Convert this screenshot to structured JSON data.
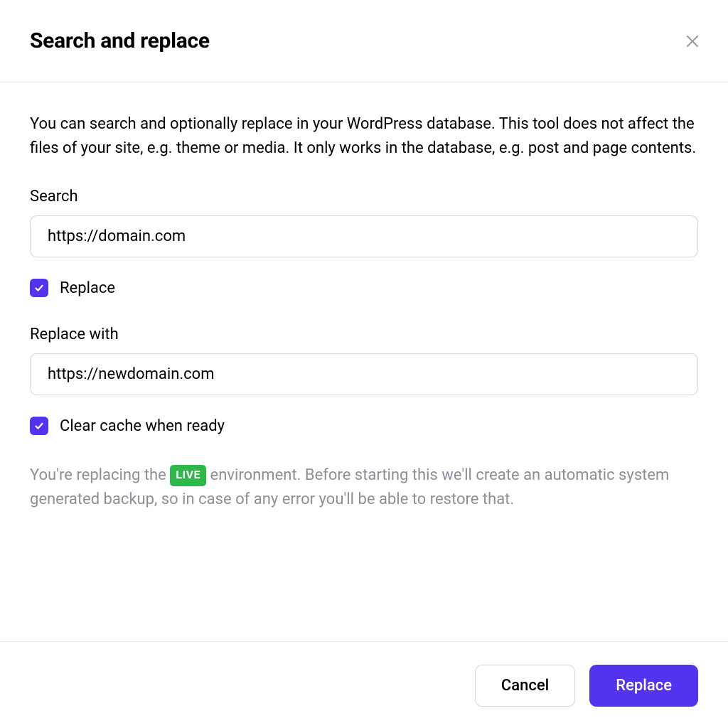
{
  "dialog": {
    "title": "Search and replace",
    "intro": "You can search and optionally replace in your WordPress database. This tool does not affect the files of your site, e.g. theme or media. It only works in the database, e.g. post and page contents.",
    "search_label": "Search",
    "search_value": "https://domain.com",
    "replace_checkbox_label": "Replace",
    "replace_checked": true,
    "replace_with_label": "Replace with",
    "replace_with_value": "https://newdomain.com",
    "clear_cache_label": "Clear cache when ready",
    "clear_cache_checked": true,
    "notice_prefix": "You're replacing the",
    "notice_badge": "LIVE",
    "notice_suffix": "environment. Before starting this we'll create an automatic system generated backup, so in case of any error you'll be able to restore that.",
    "cancel_label": "Cancel",
    "submit_label": "Replace"
  },
  "colors": {
    "accent": "#5333ED",
    "live_badge": "#2DB84C",
    "muted_text": "#8a8f98"
  }
}
